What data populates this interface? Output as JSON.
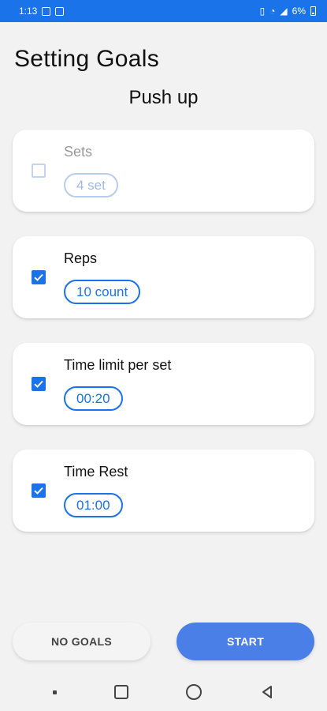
{
  "status_bar": {
    "time": "1:13",
    "battery": "6%"
  },
  "header": {
    "title": "Setting Goals",
    "exercise": "Push up"
  },
  "goals": [
    {
      "label": "Sets",
      "value": "4 set",
      "checked": false
    },
    {
      "label": "Reps",
      "value": "10 count",
      "checked": true
    },
    {
      "label": "Time limit per set",
      "value": "00:20",
      "checked": true
    },
    {
      "label": "Time Rest",
      "value": "01:00",
      "checked": true
    }
  ],
  "actions": {
    "no_goals": "NO GOALS",
    "start": "START"
  },
  "colors": {
    "accent": "#1a73e8",
    "start_button": "#4a7fe8",
    "background": "#f2f2f2"
  },
  "icons": {
    "nav": [
      "recent-dot-icon",
      "home-square-icon",
      "home-circle-icon",
      "back-triangle-icon"
    ]
  }
}
